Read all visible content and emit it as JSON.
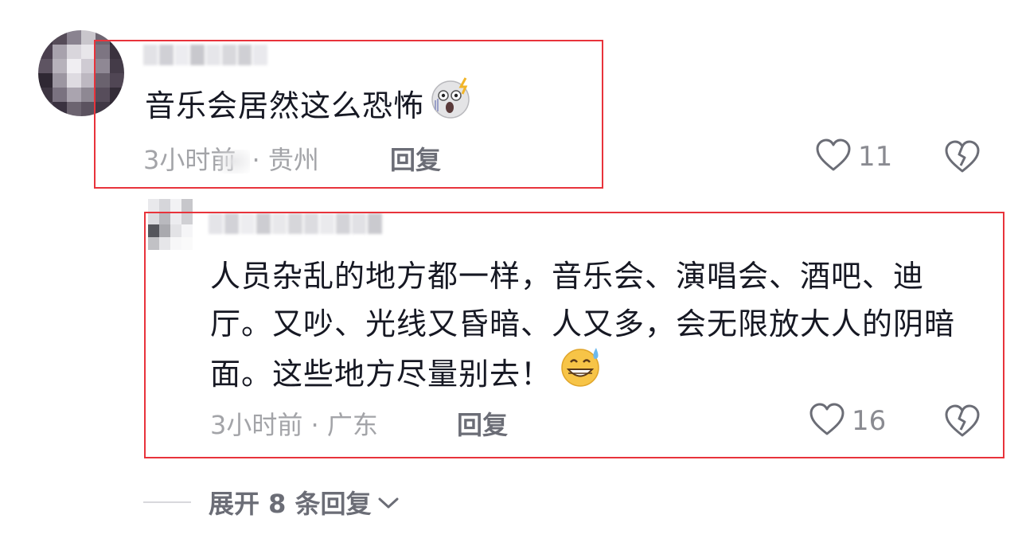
{
  "comment": {
    "text": "音乐会居然这么恐怖",
    "time": "3小时前",
    "separator": "·",
    "location": "贵州",
    "reply_label": "回复",
    "like_count": "11",
    "emoji_icon": "screaming-face-icon"
  },
  "reply": {
    "text": "人员杂乱的地方都一样，音乐会、演唱会、酒吧、迪厅。又吵、光线又昏暗、人又多，会无限放大人的阴暗面。这些地方尽量别去！",
    "time": "3小时前",
    "separator": "·",
    "location": "广东",
    "reply_label": "回复",
    "like_count": "16",
    "emoji_icon": "grinning-sweat-icon"
  },
  "expand": {
    "label": "展开 8 条回复"
  },
  "colors": {
    "highlight_box": "#e8333b",
    "meta_text": "#a3a4a8",
    "action_text": "#6b6d76"
  }
}
